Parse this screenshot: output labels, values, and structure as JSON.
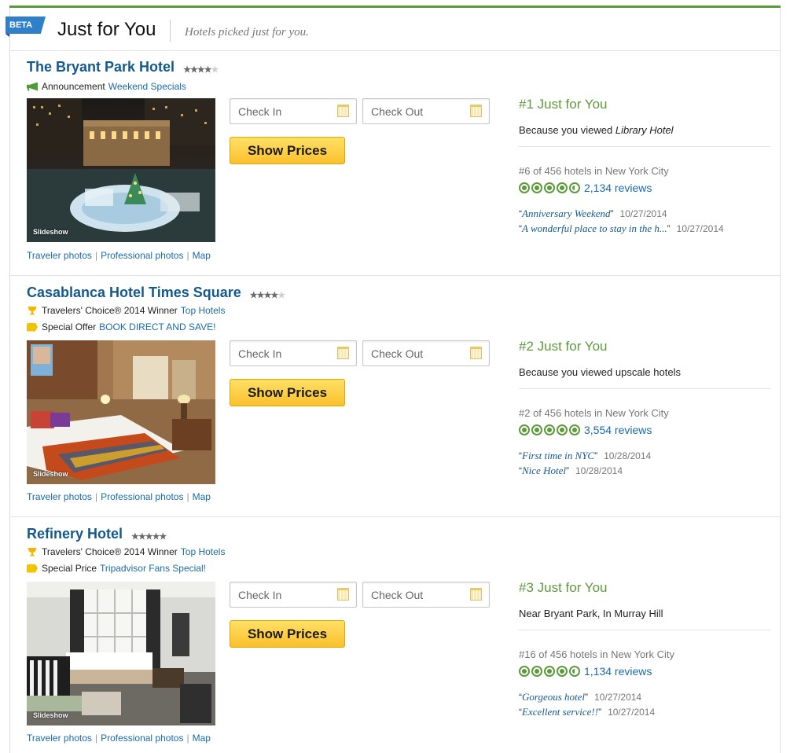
{
  "header": {
    "beta_label": "BETA",
    "title": "Just for You",
    "subtitle": "Hotels picked just for you."
  },
  "colors": {
    "accent_green": "#5c9a3b",
    "link_blue": "#1a6aa8",
    "title_blue": "#14598e",
    "button_yellow": "#fbc02d"
  },
  "common": {
    "check_in_placeholder": "Check In",
    "check_out_placeholder": "Check Out",
    "show_prices_label": "Show Prices",
    "slideshow_label": "Slideshow",
    "link_traveler_photos": "Traveler photos",
    "link_professional_photos": "Professional photos",
    "link_map": "Map",
    "pipe": "|"
  },
  "hotels": [
    {
      "name": "The Bryant Park Hotel",
      "stars": 4,
      "badges": [
        {
          "icon": "megaphone-icon",
          "label": "Announcement",
          "link": "Weekend Specials"
        }
      ],
      "rank_label": "#1 Just for You",
      "reason_prefix": "Because you viewed ",
      "reason_emph": "Library Hotel",
      "city_rank": "#6 of 456 hotels in New York City",
      "bubble_rating": 4.5,
      "reviews": "2,134 reviews",
      "review_quotes": [
        {
          "title": "Anniversary Weekend",
          "date": "10/27/2014"
        },
        {
          "title": "A wonderful place to stay in the h...",
          "date": "10/27/2014"
        }
      ]
    },
    {
      "name": "Casablanca Hotel Times Square",
      "stars": 4,
      "badges": [
        {
          "icon": "trophy-icon",
          "label": "Travelers' Choice® 2014 Winner",
          "link": "Top Hotels"
        },
        {
          "icon": "tag-icon",
          "label": "Special Offer",
          "link": "BOOK DIRECT AND SAVE!"
        }
      ],
      "rank_label": "#2 Just for You",
      "reason_prefix": "Because you viewed upscale hotels",
      "reason_emph": "",
      "city_rank": "#2 of 456 hotels in New York City",
      "bubble_rating": 5,
      "reviews": "3,554 reviews",
      "review_quotes": [
        {
          "title": "First time in NYC",
          "date": "10/28/2014"
        },
        {
          "title": "Nice Hotel",
          "date": "10/28/2014"
        }
      ]
    },
    {
      "name": "Refinery Hotel",
      "stars": 5,
      "badges": [
        {
          "icon": "trophy-icon",
          "label": "Travelers' Choice® 2014 Winner",
          "link": "Top Hotels"
        },
        {
          "icon": "tag-icon",
          "label": "Special Price",
          "link": "Tripadvisor Fans Special!"
        }
      ],
      "rank_label": "#3 Just for You",
      "reason_prefix": "Near Bryant Park, In Murray Hill",
      "reason_emph": "",
      "city_rank": "#16 of 456 hotels in New York City",
      "bubble_rating": 4.5,
      "reviews": "1,134 reviews",
      "review_quotes": [
        {
          "title": "Gorgeous hotel",
          "date": "10/27/2014"
        },
        {
          "title": "Excellent service!!",
          "date": "10/27/2014"
        }
      ]
    }
  ]
}
